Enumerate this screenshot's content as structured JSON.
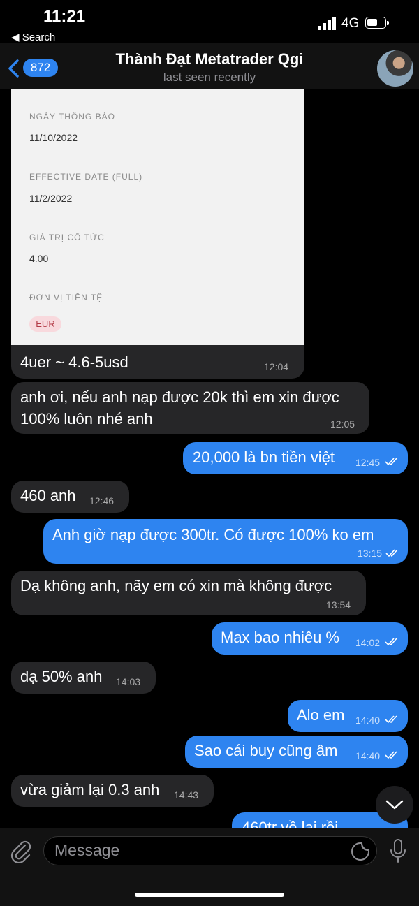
{
  "status": {
    "time": "11:21",
    "back": "◀ Search",
    "network": "4G"
  },
  "header": {
    "unread": "872",
    "title": "Thành Đạt Metatrader Qgi",
    "subtitle": "last seen recently"
  },
  "card": {
    "fields": [
      {
        "label": "NGÀY THÔNG BÁO",
        "value": "11/10/2022"
      },
      {
        "label": "EFFECTIVE DATE (FULL)",
        "value": "11/2/2022"
      },
      {
        "label": "GIÁ TRỊ CỔ TỨC",
        "value": "4.00"
      },
      {
        "label": "ĐƠN VỊ TIỀN TỆ",
        "value": "EUR"
      }
    ],
    "caption": "4uer ~ 4.6-5usd",
    "time": "12:04"
  },
  "messages": [
    {
      "text1": "anh ơi, nếu anh nạp được 20k thì em xin được",
      "text2": "100% luôn nhé anh",
      "time": "12:05"
    },
    {
      "text": "20,000 là bn tiền việt",
      "time": "12:45"
    },
    {
      "text": "460 anh",
      "time": "12:46"
    },
    {
      "text": "Anh giờ nạp được 300tr. Có được 100% ko em",
      "time": "13:15"
    },
    {
      "text": "Dạ không anh, nãy em có xin mà không được",
      "time": "13:54"
    },
    {
      "text": "Max bao nhiêu %",
      "time": "14:02"
    },
    {
      "text": "dạ 50% anh",
      "time": "14:03"
    },
    {
      "text": "Alo em",
      "time": "14:40"
    },
    {
      "text": "Sao cái buy cũng âm",
      "time": "14:40"
    },
    {
      "text": "vừa giảm lại 0.3 anh",
      "time": "14:43"
    },
    {
      "text": "460tr về lại rồi"
    }
  ],
  "input": {
    "placeholder": "Message"
  },
  "colors": {
    "outgoing": "#2e84f0",
    "incoming": "#262628",
    "background": "#000000"
  }
}
